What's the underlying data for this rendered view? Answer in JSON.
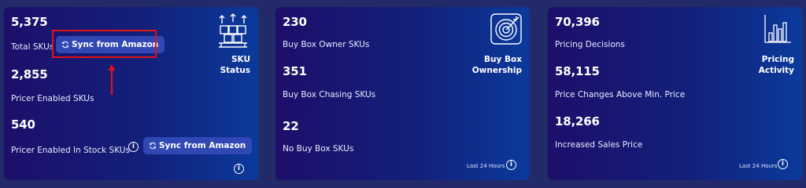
{
  "sku_card": {
    "title_line1": "SKU",
    "title_line2": "Status",
    "total_skus_value": "5,375",
    "total_skus_label": "Total SKUs",
    "pricer_enabled_value": "2,855",
    "pricer_enabled_label": "Pricer Enabled SKUs",
    "in_stock_value": "540",
    "in_stock_label": "Pricer Enabled In Stock SKUs",
    "sync_button_label": "Sync from Amazon",
    "sync_button2_label": "Sync from Amazon",
    "info_glyph": "i",
    "icon": "warehouse-boxes-icon"
  },
  "buybox_card": {
    "title_line1": "Buy Box",
    "title_line2": "Ownership",
    "owner_value": "230",
    "owner_label": "Buy Box Owner SKUs",
    "chasing_value": "351",
    "chasing_label": "Buy Box Chasing SKUs",
    "no_buybox_value": "22",
    "no_buybox_label": "No Buy Box SKUs",
    "footer": "Last 24 Hours",
    "info_glyph": "i",
    "icon": "target-icon"
  },
  "pricing_card": {
    "title_line1": "Pricing",
    "title_line2": "Activity",
    "decisions_value": "70,396",
    "decisions_label": "Pricing Decisions",
    "above_min_value": "58,115",
    "above_min_label": "Price Changes Above Min. Price",
    "increased_value": "18,266",
    "increased_label": "Increased Sales Price",
    "footer": "Last 24 Hours",
    "info_glyph": "i",
    "icon": "bar-chart-icon"
  },
  "colors": {
    "page_background": "#232a6a",
    "card_gradient_start": "#1c0f6a",
    "card_gradient_end": "#0b3a9c",
    "button": "#3147b4",
    "annotation_red": "#e01313"
  }
}
